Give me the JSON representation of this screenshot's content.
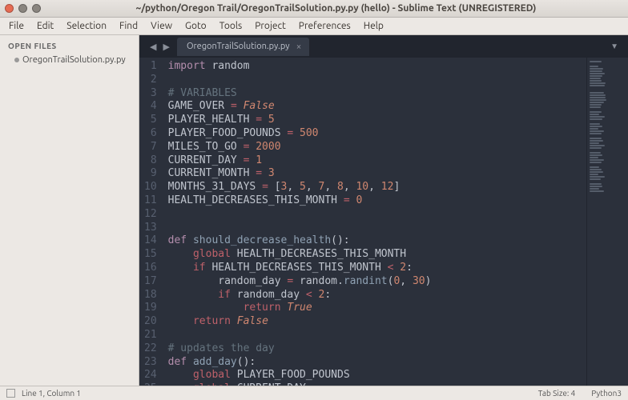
{
  "window": {
    "title": "~/python/Oregon Trail/OregonTrailSolution.py.py (hello) - Sublime Text (UNREGISTERED)"
  },
  "menus": [
    "File",
    "Edit",
    "Selection",
    "Find",
    "View",
    "Goto",
    "Tools",
    "Project",
    "Preferences",
    "Help"
  ],
  "sidebar": {
    "heading": "OPEN FILES",
    "files": [
      "OregonTrailSolution.py.py"
    ]
  },
  "tabs": [
    {
      "label": "OregonTrailSolution.py.py"
    }
  ],
  "tabbar": {
    "arrow_left": "◀",
    "arrow_right": "▶",
    "close": "×",
    "more": "▼"
  },
  "code_lines": [
    [
      [
        "import",
        "kw-import"
      ],
      [
        " ",
        "op"
      ],
      [
        "random",
        "ident"
      ]
    ],
    [],
    [
      [
        "# VARIABLES",
        "comment"
      ]
    ],
    [
      [
        "GAME_OVER",
        "ident"
      ],
      [
        " ",
        "op"
      ],
      [
        "=",
        "kw-red"
      ],
      [
        " ",
        "op"
      ],
      [
        "False",
        "const-false"
      ]
    ],
    [
      [
        "PLAYER_HEALTH",
        "ident"
      ],
      [
        " ",
        "op"
      ],
      [
        "=",
        "kw-red"
      ],
      [
        " ",
        "op"
      ],
      [
        "5",
        "num"
      ]
    ],
    [
      [
        "PLAYER_FOOD_POUNDS",
        "ident"
      ],
      [
        " ",
        "op"
      ],
      [
        "=",
        "kw-red"
      ],
      [
        " ",
        "op"
      ],
      [
        "500",
        "num"
      ]
    ],
    [
      [
        "MILES_TO_GO",
        "ident"
      ],
      [
        " ",
        "op"
      ],
      [
        "=",
        "kw-red"
      ],
      [
        " ",
        "op"
      ],
      [
        "2000",
        "num"
      ]
    ],
    [
      [
        "CURRENT_DAY",
        "ident"
      ],
      [
        " ",
        "op"
      ],
      [
        "=",
        "kw-red"
      ],
      [
        " ",
        "op"
      ],
      [
        "1",
        "num"
      ]
    ],
    [
      [
        "CURRENT_MONTH",
        "ident"
      ],
      [
        " ",
        "op"
      ],
      [
        "=",
        "kw-red"
      ],
      [
        " ",
        "op"
      ],
      [
        "3",
        "num"
      ]
    ],
    [
      [
        "MONTHS_31_DAYS",
        "ident"
      ],
      [
        " ",
        "op"
      ],
      [
        "=",
        "kw-red"
      ],
      [
        " [",
        "op"
      ],
      [
        "3",
        "num"
      ],
      [
        ", ",
        "op"
      ],
      [
        "5",
        "num"
      ],
      [
        ", ",
        "op"
      ],
      [
        "7",
        "num"
      ],
      [
        ", ",
        "op"
      ],
      [
        "8",
        "num"
      ],
      [
        ", ",
        "op"
      ],
      [
        "10",
        "num"
      ],
      [
        ", ",
        "op"
      ],
      [
        "12",
        "num"
      ],
      [
        "]",
        "op"
      ]
    ],
    [
      [
        "HEALTH_DECREASES_THIS_MONTH",
        "ident"
      ],
      [
        " ",
        "op"
      ],
      [
        "=",
        "kw-red"
      ],
      [
        " ",
        "op"
      ],
      [
        "0",
        "num"
      ]
    ],
    [],
    [],
    [
      [
        "def",
        "kw-def"
      ],
      [
        " ",
        "op"
      ],
      [
        "should_decrease_health",
        "fn-name"
      ],
      [
        "():",
        "op"
      ]
    ],
    [
      [
        "    ",
        "op"
      ],
      [
        "global",
        "kw-red"
      ],
      [
        " HEALTH_DECREASES_THIS_MONTH",
        "ident"
      ]
    ],
    [
      [
        "    ",
        "op"
      ],
      [
        "if",
        "kw-red"
      ],
      [
        " HEALTH_DECREASES_THIS_MONTH ",
        "ident"
      ],
      [
        "<",
        "kw-red"
      ],
      [
        " ",
        "op"
      ],
      [
        "2",
        "num"
      ],
      [
        ":",
        "op"
      ]
    ],
    [
      [
        "        random_day ",
        "ident"
      ],
      [
        "=",
        "kw-red"
      ],
      [
        " random.",
        "ident"
      ],
      [
        "randint",
        "builtin"
      ],
      [
        "(",
        "op"
      ],
      [
        "0",
        "num"
      ],
      [
        ", ",
        "op"
      ],
      [
        "30",
        "num"
      ],
      [
        ")",
        "op"
      ]
    ],
    [
      [
        "        ",
        "op"
      ],
      [
        "if",
        "kw-red"
      ],
      [
        " random_day ",
        "ident"
      ],
      [
        "<",
        "kw-red"
      ],
      [
        " ",
        "op"
      ],
      [
        "2",
        "num"
      ],
      [
        ":",
        "op"
      ]
    ],
    [
      [
        "            ",
        "op"
      ],
      [
        "return",
        "kw-red"
      ],
      [
        " ",
        "op"
      ],
      [
        "True",
        "const-true"
      ]
    ],
    [
      [
        "    ",
        "op"
      ],
      [
        "return",
        "kw-red"
      ],
      [
        " ",
        "op"
      ],
      [
        "False",
        "const-false"
      ]
    ],
    [],
    [
      [
        "# updates the day",
        "comment"
      ]
    ],
    [
      [
        "def",
        "kw-def"
      ],
      [
        " ",
        "op"
      ],
      [
        "add_day",
        "fn-name"
      ],
      [
        "():",
        "op"
      ]
    ],
    [
      [
        "    ",
        "op"
      ],
      [
        "global",
        "kw-red"
      ],
      [
        " PLAYER_FOOD_POUNDS",
        "ident"
      ]
    ],
    [
      [
        "    ",
        "op"
      ],
      [
        "global",
        "kw-red"
      ],
      [
        " CURRENT_DAY",
        "ident"
      ]
    ]
  ],
  "status": {
    "left": "Line 1, Column 1",
    "tabsize": "Tab Size: 4",
    "syntax": "Python3"
  },
  "minimap_widths": [
    38,
    0,
    28,
    42,
    40,
    48,
    40,
    34,
    36,
    50,
    48,
    0,
    0,
    44,
    50,
    50,
    52,
    44,
    38,
    34,
    0,
    36,
    30,
    46,
    40,
    0,
    32,
    40,
    28,
    44,
    36,
    0,
    38,
    42,
    30,
    46,
    38,
    0,
    34,
    40,
    28,
    44,
    36,
    0,
    30,
    38,
    42,
    28,
    46,
    34,
    0,
    36,
    40,
    30,
    44
  ],
  "colors": {
    "bg": "#2b303b",
    "gutter_text": "#586070",
    "tab_bg": "#353b47"
  }
}
